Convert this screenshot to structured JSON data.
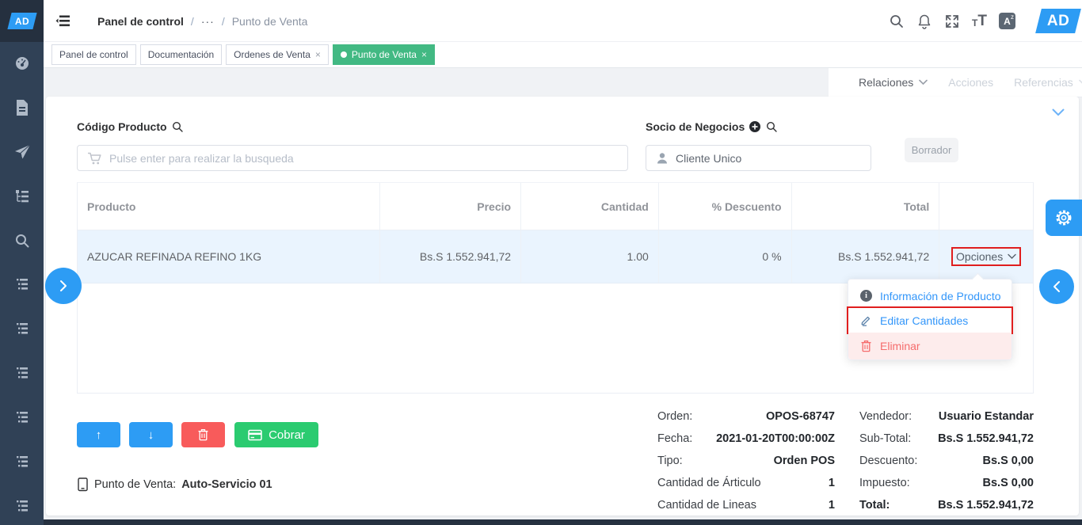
{
  "brand": {
    "logo_text": "AD"
  },
  "header": {
    "breadcrumb": {
      "item1": "Panel de control",
      "separator": "/",
      "ellipsis": "···",
      "item2": "Punto de Venta"
    },
    "font_small": "T",
    "font_large": "T",
    "lang_letter": "A",
    "lang_sup": "z"
  },
  "tabs": {
    "t0": "Panel de control",
    "t1": "Documentación",
    "t2": "Ordenes de Venta",
    "t3": "Punto de Venta",
    "close": "×"
  },
  "menubar": {
    "relaciones": "Relaciones",
    "acciones": "Acciones",
    "referencias": "Referencias"
  },
  "pos": {
    "product_label": "Código Producto",
    "product_placeholder": "Pulse enter para realizar la busqueda",
    "partner_label": "Socio de Negocios",
    "partner_value": "Cliente Unico",
    "status_button": "Borrador",
    "table": {
      "headers": {
        "product": "Producto",
        "price": "Precio",
        "qty": "Cantidad",
        "discount": "% Descuento",
        "total": "Total"
      },
      "row": {
        "product": "AZUCAR REFINADA REFINO 1KG",
        "price": "Bs.S 1.552.941,72",
        "qty": "1.00",
        "discount": "0 %",
        "total": "Bs.S 1.552.941,72",
        "options": "Opciones"
      }
    },
    "options_menu": {
      "info": "Información de Producto",
      "edit": "Editar Cantidades",
      "delete": "Eliminar"
    },
    "actions": {
      "up": "↑",
      "down": "↓",
      "cobrar": "Cobrar"
    },
    "pos_terminal": {
      "label": "Punto de Venta:",
      "value": "Auto-Servicio 01"
    },
    "summary_left": {
      "order_label": "Orden:",
      "order_value": "OPOS-68747",
      "date_label": "Fecha:",
      "date_value": "2021-01-20T00:00:00Z",
      "type_label": "Tipo:",
      "type_value": "Orden POS",
      "items_label": "Cantidad de Árticulo",
      "items_value": "1",
      "lines_label": "Cantidad de Lineas",
      "lines_value": "1"
    },
    "summary_right": {
      "seller_label": "Vendedor:",
      "seller_value": "Usuario Estandar",
      "subtotal_label": "Sub-Total:",
      "subtotal_value": "Bs.S 1.552.941,72",
      "discount_label": "Descuento:",
      "discount_value": "Bs.S 0,00",
      "tax_label": "Impuesto:",
      "tax_value": "Bs.S 0,00",
      "total_label": "Total:",
      "total_value": "Bs.S 1.552.941,72"
    }
  },
  "colors": {
    "accent_blue": "#2d9cf4",
    "tab_green": "#42b983",
    "cobrar_green": "#2bcb70",
    "danger_red": "#f85b5b",
    "annotation_red": "#e01e1e",
    "sidebar_navy": "#304156",
    "row_highlight": "#eaf4fe"
  },
  "icons": {
    "list": [
      "menu-collapse",
      "search",
      "bell",
      "fullscreen",
      "font-size",
      "language",
      "dashboard",
      "document",
      "send",
      "menu-tree",
      "cart",
      "user",
      "plus-circle",
      "info",
      "pencil",
      "trash",
      "card",
      "device",
      "gear",
      "chevron"
    ]
  }
}
